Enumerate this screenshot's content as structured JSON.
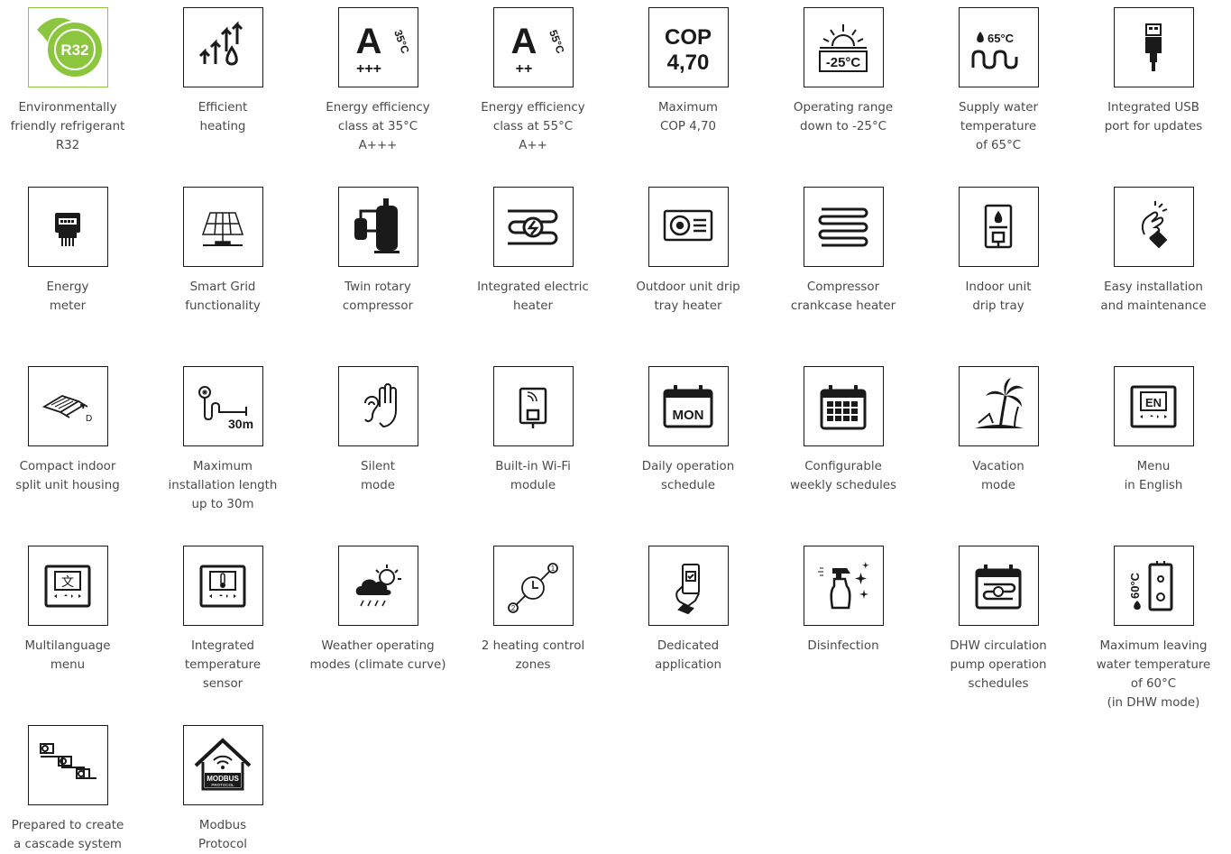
{
  "colors": {
    "icon": "#1a1a1a",
    "label": "#4a4a4a",
    "accent_green": "#8cc63f",
    "border": "#1a1a1a"
  },
  "features": [
    {
      "icon": "r32-refrigerant-icon",
      "label": "Environmentally\nfriendly refrigerant\nR32",
      "badge": "R32"
    },
    {
      "icon": "efficient-heating-icon",
      "label": "Efficient\nheating"
    },
    {
      "icon": "energy-class-35-icon",
      "label": "Energy efficiency\nclass at 35°C\nA+++",
      "badge_letter": "A",
      "badge_temp": "35°C",
      "badge_plus": "+++"
    },
    {
      "icon": "energy-class-55-icon",
      "label": "Energy efficiency\nclass at 55°C\nA++",
      "badge_letter": "A",
      "badge_temp": "55°C",
      "badge_plus": "++"
    },
    {
      "icon": "cop-icon",
      "label": "Maximum\nCOP 4,70",
      "badge_top": "COP",
      "badge_value": "4,70"
    },
    {
      "icon": "operating-range-icon",
      "label": "Operating range\ndown to -25°C",
      "badge": "-25°C"
    },
    {
      "icon": "supply-water-temp-icon",
      "label": "Supply water\ntemperature\nof 65°C",
      "badge": "65°C"
    },
    {
      "icon": "usb-port-icon",
      "label": "Integrated USB\nport for updates"
    },
    {
      "icon": "energy-meter-icon",
      "label": "Energy\nmeter"
    },
    {
      "icon": "smart-grid-icon",
      "label": "Smart Grid\nfunctionality"
    },
    {
      "icon": "twin-rotary-compressor-icon",
      "label": "Twin rotary\ncompressor"
    },
    {
      "icon": "electric-heater-icon",
      "label": "Integrated electric\nheater"
    },
    {
      "icon": "drip-tray-heater-icon",
      "label": "Outdoor unit drip\ntray heater"
    },
    {
      "icon": "crankcase-heater-icon",
      "label": "Compressor\ncrankcase heater"
    },
    {
      "icon": "indoor-drip-tray-icon",
      "label": "Indoor unit\ndrip tray"
    },
    {
      "icon": "easy-installation-icon",
      "label": "Easy installation\nand maintenance"
    },
    {
      "icon": "compact-housing-icon",
      "label": "Compact indoor\nsplit unit housing",
      "badge": "D"
    },
    {
      "icon": "installation-length-icon",
      "label": "Maximum\ninstallation length\nup to 30m",
      "badge": "30m"
    },
    {
      "icon": "silent-mode-icon",
      "label": "Silent\nmode"
    },
    {
      "icon": "wifi-module-icon",
      "label": "Built-in Wi-Fi\nmodule"
    },
    {
      "icon": "daily-schedule-icon",
      "label": "Daily operation\nschedule",
      "badge": "MON"
    },
    {
      "icon": "weekly-schedule-icon",
      "label": "Configurable\nweekly schedules"
    },
    {
      "icon": "vacation-mode-icon",
      "label": "Vacation\nmode"
    },
    {
      "icon": "menu-english-icon",
      "label": "Menu\nin English",
      "badge": "EN"
    },
    {
      "icon": "multilanguage-menu-icon",
      "label": "Multilanguage\nmenu",
      "badge": "文"
    },
    {
      "icon": "temperature-sensor-icon",
      "label": "Integrated\ntemperature\nsensor"
    },
    {
      "icon": "weather-curve-icon",
      "label": "Weather operating\nmodes (climate curve)"
    },
    {
      "icon": "heating-zones-icon",
      "label": "2 heating control\nzones",
      "badge_1": "1",
      "badge_2": "2"
    },
    {
      "icon": "mobile-app-icon",
      "label": "Dedicated\napplication"
    },
    {
      "icon": "disinfection-icon",
      "label": "Disinfection"
    },
    {
      "icon": "dhw-pump-schedule-icon",
      "label": "DHW circulation\npump operation\nschedules"
    },
    {
      "icon": "max-leaving-water-icon",
      "label": "Maximum leaving\nwater temperature\nof 60°C\n(in DHW mode)",
      "badge": "60°C"
    },
    {
      "icon": "cascade-system-icon",
      "label": "Prepared to create\na cascade system"
    },
    {
      "icon": "modbus-protocol-icon",
      "label": "Modbus\nProtocol",
      "badge_top": "MODBUS",
      "badge_bottom": "PROTOCOL"
    }
  ]
}
